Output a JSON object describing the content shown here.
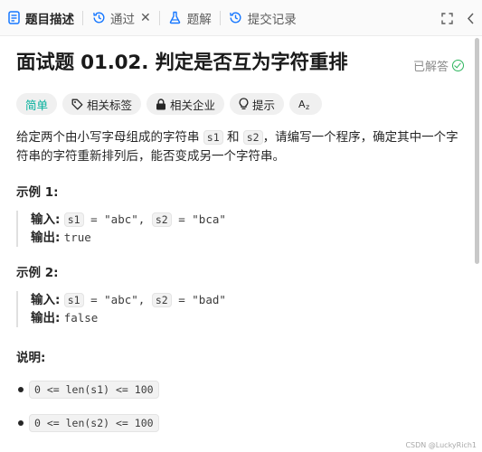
{
  "tabs": [
    {
      "label": "题目描述",
      "icon": "description-icon",
      "active": true
    },
    {
      "label": "通过",
      "icon": "history-icon",
      "closable": true
    },
    {
      "label": "题解",
      "icon": "flask-icon"
    },
    {
      "label": "提交记录",
      "icon": "history-icon"
    }
  ],
  "toolbar": {
    "maximize_icon": "maximize-icon",
    "collapse_icon": "chevron-left-icon",
    "close_symbol": "✕"
  },
  "problem": {
    "title": "面试题 01.02. 判定是否互为字符重排",
    "status": "已解答",
    "tags": [
      {
        "label": "简单",
        "icon": ""
      },
      {
        "label": "相关标签",
        "icon": "tag-icon"
      },
      {
        "label": "相关企业",
        "icon": "lock-icon"
      },
      {
        "label": "提示",
        "icon": "lightbulb-icon"
      },
      {
        "label": "",
        "icon": "translate-icon"
      }
    ],
    "description": {
      "p1": "给定两个由小写字母组成的字符串 ",
      "s1": "s1",
      "p2": " 和 ",
      "s2": "s2",
      "p3": "，请编写一个程序，确定其中一个字符串的字符重新排列后，能否变成另一个字符串。"
    },
    "examples": [
      {
        "heading": "示例 1:",
        "input_label": "输入:",
        "s1_name": "s1",
        "s1_val": " = \"abc\", ",
        "s2_name": "s2",
        "s2_val": " = \"bca\"",
        "output_label": "输出:",
        "output": "true"
      },
      {
        "heading": "示例 2:",
        "input_label": "输入:",
        "s1_name": "s1",
        "s1_val": " = \"abc\", ",
        "s2_name": "s2",
        "s2_val": " = \"bad\"",
        "output_label": "输出:",
        "output": "false"
      }
    ],
    "notes_heading": "说明:",
    "notes": [
      "0 <= len(s1) <= 100",
      "0 <= len(s2) <= 100"
    ]
  },
  "watermark": "CSDN @LuckyRich1"
}
